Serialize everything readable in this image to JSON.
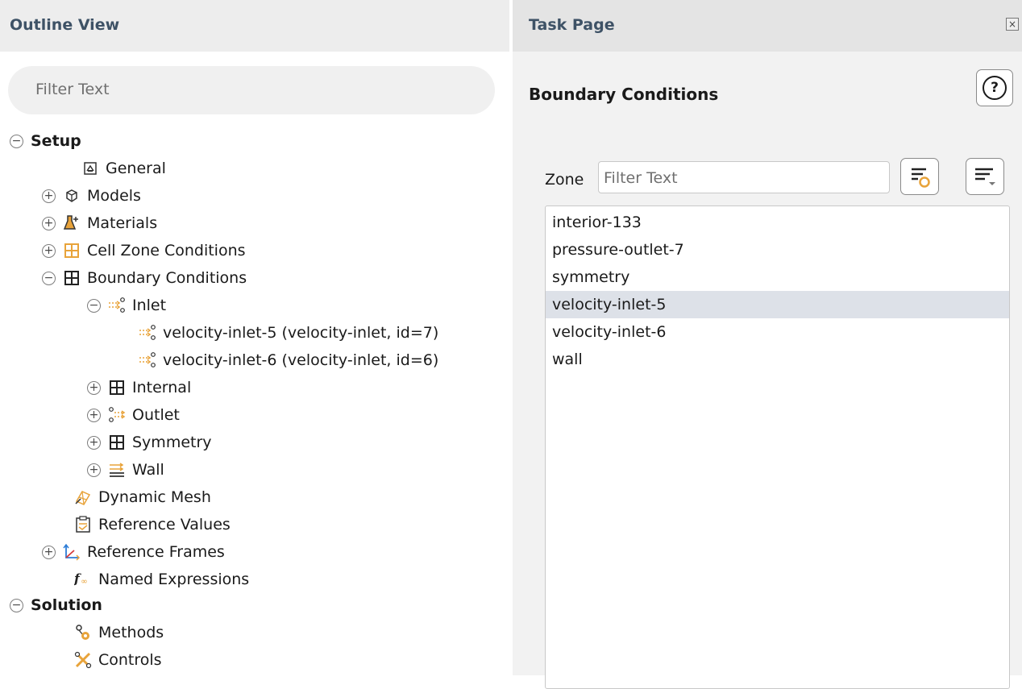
{
  "outline": {
    "title": "Outline View",
    "filter_placeholder": "Filter Text",
    "tree": [
      {
        "label": "Setup",
        "toggle": "−"
      },
      {
        "label": "General"
      },
      {
        "label": "Models",
        "toggle": "+"
      },
      {
        "label": "Materials",
        "toggle": "+"
      },
      {
        "label": "Cell Zone Conditions",
        "toggle": "+"
      },
      {
        "label": "Boundary Conditions",
        "toggle": "−"
      },
      {
        "label": "Inlet",
        "toggle": "−"
      },
      {
        "label": "velocity-inlet-5 (velocity-inlet, id=7)"
      },
      {
        "label": "velocity-inlet-6 (velocity-inlet, id=6)"
      },
      {
        "label": "Internal",
        "toggle": "+"
      },
      {
        "label": "Outlet",
        "toggle": "+"
      },
      {
        "label": "Symmetry",
        "toggle": "+"
      },
      {
        "label": "Wall",
        "toggle": "+"
      },
      {
        "label": "Dynamic Mesh"
      },
      {
        "label": "Reference Values"
      },
      {
        "label": "Reference Frames",
        "toggle": "+"
      },
      {
        "label": "Named Expressions"
      },
      {
        "label": "Solution",
        "toggle": "−"
      },
      {
        "label": "Methods"
      },
      {
        "label": "Controls"
      }
    ]
  },
  "task": {
    "title": "Task Page",
    "close_glyph": "×",
    "panel_title": "Boundary Conditions",
    "help_glyph": "?",
    "zone_label": "Zone",
    "zone_filter_placeholder": "Filter Text",
    "zones": [
      {
        "label": "interior-133",
        "selected": false
      },
      {
        "label": "pressure-outlet-7",
        "selected": false
      },
      {
        "label": "symmetry",
        "selected": false
      },
      {
        "label": "velocity-inlet-5",
        "selected": true
      },
      {
        "label": "velocity-inlet-6",
        "selected": false
      },
      {
        "label": "wall",
        "selected": false
      }
    ]
  },
  "colors": {
    "header_text": "#3e5266",
    "selection": "#dde1e8",
    "icon_orange": "#e8a33a",
    "icon_dark": "#333333"
  }
}
